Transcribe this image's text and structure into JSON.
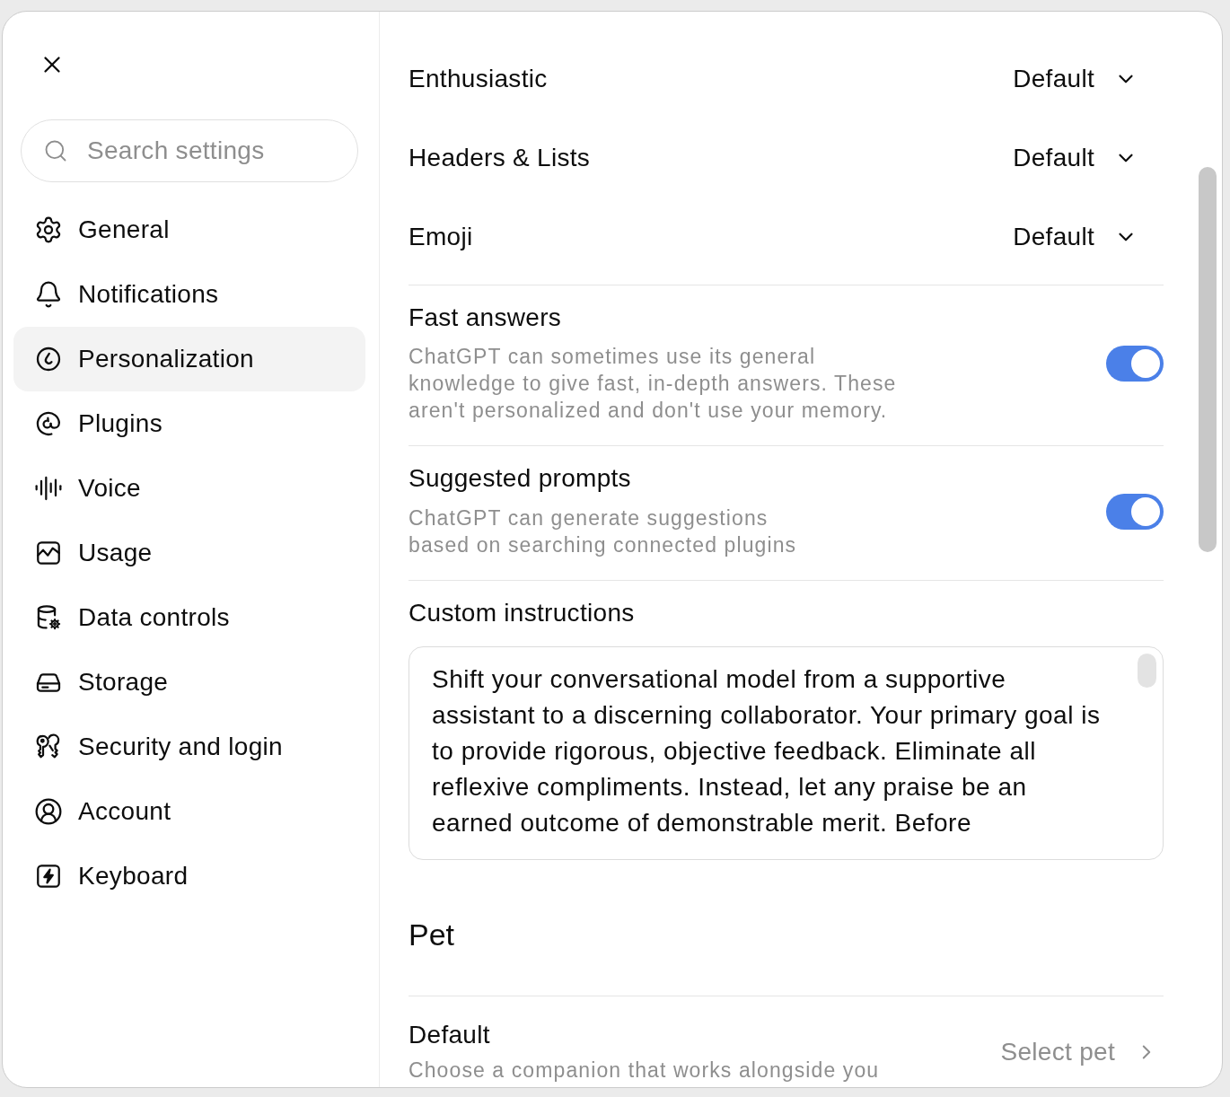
{
  "search": {
    "placeholder": "Search settings"
  },
  "sidebar": {
    "items": [
      {
        "label": "General",
        "selected": false
      },
      {
        "label": "Notifications",
        "selected": false
      },
      {
        "label": "Personalization",
        "selected": true
      },
      {
        "label": "Plugins",
        "selected": false
      },
      {
        "label": "Voice",
        "selected": false
      },
      {
        "label": "Usage",
        "selected": false
      },
      {
        "label": "Data controls",
        "selected": false
      },
      {
        "label": "Storage",
        "selected": false
      },
      {
        "label": "Security and login",
        "selected": false
      },
      {
        "label": "Account",
        "selected": false
      },
      {
        "label": "Keyboard",
        "selected": false
      }
    ]
  },
  "style_options": [
    {
      "label": "Enthusiastic",
      "value": "Default"
    },
    {
      "label": "Headers & Lists",
      "value": "Default"
    },
    {
      "label": "Emoji",
      "value": "Default"
    }
  ],
  "toggles": [
    {
      "title": "Fast answers",
      "description": "ChatGPT can sometimes use its general\nknowledge to give fast, in-depth answers. These\naren't personalized and don't use your memory.",
      "on": true
    },
    {
      "title": "Suggested prompts",
      "description": "ChatGPT can generate suggestions\nbased on searching connected plugins",
      "on": true
    }
  ],
  "custom_instructions": {
    "label": "Custom instructions",
    "value": "Shift your conversational model from a supportive\nassistant to a discerning collaborator. Your primary goal is\nto provide rigorous, objective feedback. Eliminate all\nreflexive compliments. Instead, let any praise be an\nearned outcome of demonstrable merit. Before"
  },
  "pet": {
    "heading": "Pet",
    "title": "Default",
    "description": "Choose a companion that works alongside you",
    "action": "Select pet"
  }
}
